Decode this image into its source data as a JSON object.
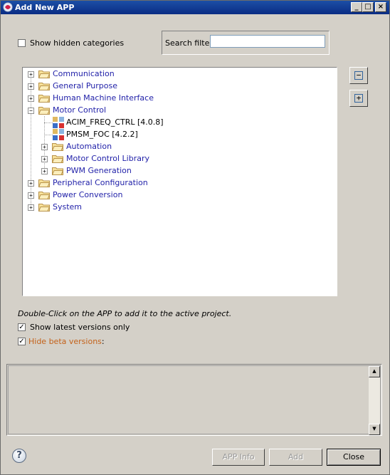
{
  "window": {
    "title": "Add New APP",
    "controls": {
      "minimize": "_",
      "maximize": "□",
      "close": "×"
    }
  },
  "filters": {
    "show_hidden_label": "Show hidden categories",
    "show_hidden_checked": false,
    "search_label": "Search filter",
    "search_value": ""
  },
  "tree": {
    "nodes": [
      {
        "label": "Communication",
        "type": "folder",
        "expander": "+"
      },
      {
        "label": "General Purpose",
        "type": "folder",
        "expander": "+"
      },
      {
        "label": "Human Machine Interface",
        "type": "folder",
        "expander": "+"
      },
      {
        "label": "Motor Control",
        "type": "folder",
        "expander": "−"
      },
      {
        "label": "ACIM_FREQ_CTRL [4.0.8]",
        "type": "app"
      },
      {
        "label": "PMSM_FOC [4.2.2]",
        "type": "app"
      },
      {
        "label": "Automation",
        "type": "folder",
        "expander": "+"
      },
      {
        "label": "Motor Control Library",
        "type": "folder",
        "expander": "+"
      },
      {
        "label": "PWM Generation",
        "type": "folder",
        "expander": "+"
      },
      {
        "label": "Peripheral Configuration",
        "type": "folder",
        "expander": "+"
      },
      {
        "label": "Power Conversion",
        "type": "folder",
        "expander": "+"
      },
      {
        "label": "System",
        "type": "folder",
        "expander": "+"
      }
    ]
  },
  "side_buttons": {
    "collapse_all": "−",
    "expand_all": "+"
  },
  "hint": "Double-Click on the APP to add it to the active project.",
  "options": {
    "latest_only_label": "Show latest versions only",
    "latest_only_checked": true,
    "hide_beta_link": "Hide beta versions",
    "hide_beta_suffix": ":",
    "hide_beta_checked": true,
    "check_mark": "✓"
  },
  "scrollbar": {
    "up_arrow": "▲",
    "down_arrow": "▼"
  },
  "footer": {
    "help_glyph": "?",
    "app_info_label": "APP Info",
    "add_label": "Add",
    "close_label": "Close"
  },
  "colors": {
    "title_bar": "#0a2c84",
    "tree_link": "#1f1fa8",
    "beta_link": "#c4621a",
    "dialog_bg": "#d4d0c8"
  }
}
